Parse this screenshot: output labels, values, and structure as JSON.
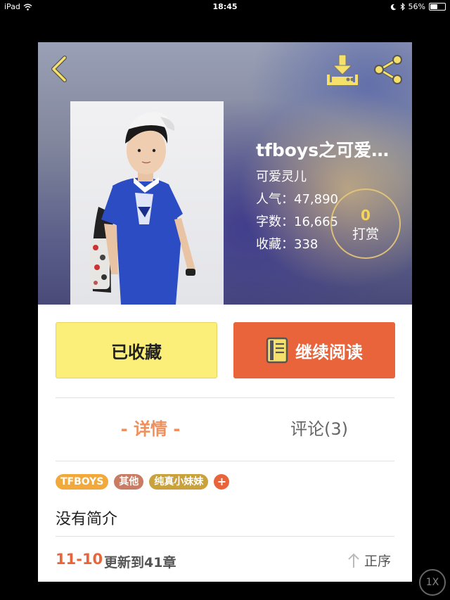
{
  "status_bar": {
    "device": "iPad",
    "time": "18:45",
    "battery": "56%",
    "battery_level": 0.56
  },
  "header": {
    "back_icon": "chevron-left-icon",
    "download_icon": "download-icon",
    "share_icon": "share-icon"
  },
  "book": {
    "title": "tfboys之可爱…",
    "author": "可爱灵儿",
    "popularity": "人气：47,890",
    "word_count": "字数：16,665",
    "favorites": "收藏：338"
  },
  "tip": {
    "count": "0",
    "label": "打赏"
  },
  "actions": {
    "favorited_label": "已收藏",
    "continue_label": "继续阅读",
    "continue_icon": "book-icon"
  },
  "tabs": {
    "details": "- 详情 -",
    "comments": "评论(3)"
  },
  "tags": [
    {
      "label": "TFBOYS",
      "color": "#f2a93b"
    },
    {
      "label": "其他",
      "color": "#c97b63"
    },
    {
      "label": "纯真小妹妹",
      "color": "#c9a23b"
    }
  ],
  "add_tag": "+",
  "description": "没有简介",
  "update": {
    "date": "11-10",
    "text": "更新到41章",
    "sort_label": "正序"
  },
  "zoom": "1X",
  "colors": {
    "accent": "#e9643a",
    "favorite_bg": "#fbef79",
    "tab_active": "#ef8f5c",
    "tip_count": "#f5d55b"
  }
}
